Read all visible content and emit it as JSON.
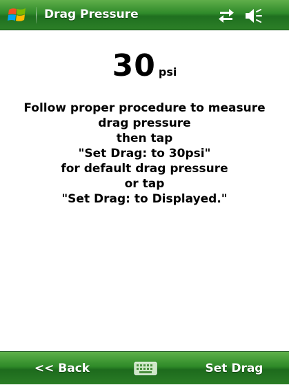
{
  "titlebar": {
    "title": "Drag Pressure",
    "start_icon": "windows-flag-icon",
    "connectivity_icon": "connectivity-arrows-icon",
    "volume_icon": "speaker-muted-icon"
  },
  "main": {
    "pressure_value": "30",
    "pressure_unit": "psi",
    "instructions": [
      "Follow proper procedure to measure",
      "drag pressure",
      "then tap",
      "\"Set Drag: to 30psi\"",
      "for default drag pressure",
      "or tap",
      "\"Set Drag: to Displayed.\""
    ]
  },
  "softkeys": {
    "left_label": "<< Back",
    "keyboard_icon": "keyboard-icon",
    "right_label": "Set Drag"
  },
  "colors": {
    "bar_green": "#2f8a2a",
    "bar_highlight": "#5fae4a",
    "text": "#000000",
    "bar_text": "#ffffff"
  }
}
